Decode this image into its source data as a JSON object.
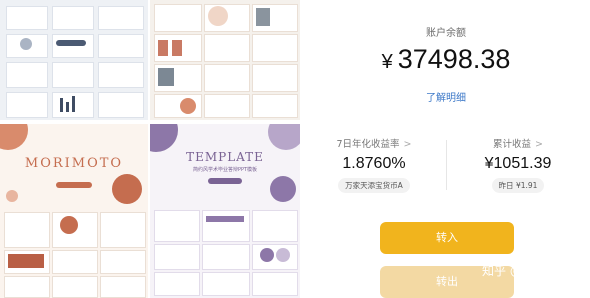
{
  "gallery": {
    "tile3_brand": "MORIMOTO",
    "tile4_brand": "TEMPLATE",
    "tile4_sub": "简约风学术毕业答辩PPT模板"
  },
  "account": {
    "balance_label": "账户余额",
    "currency": "¥",
    "balance": "37498.38",
    "detail_link": "了解明细"
  },
  "stats": {
    "yield_label": "7日年化收益率",
    "yield_value": "1.8760%",
    "fund_name": "万家天添宝货币A",
    "earnings_label": "累计收益",
    "earnings_value": "¥1051.39",
    "yesterday": "昨日 ¥1.91"
  },
  "actions": {
    "deposit": "转入",
    "withdraw": "转出"
  },
  "watermark": "知乎 @学悟",
  "colors": {
    "primary": "#f1b41d",
    "secondary": "#f3d9a3",
    "link": "#3c78c8"
  }
}
